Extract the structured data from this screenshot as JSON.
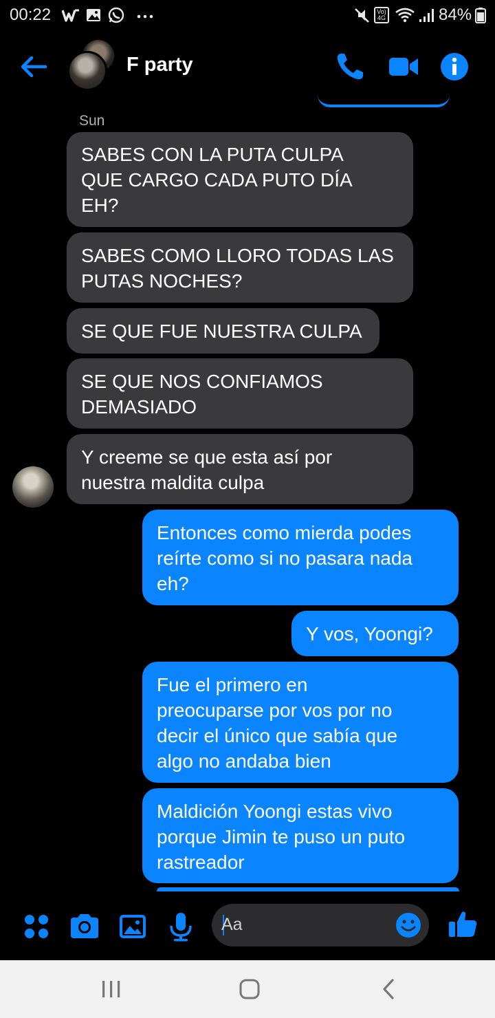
{
  "status_bar": {
    "time": "00:22",
    "battery": "84%",
    "volte": "Vo) 4G",
    "icons": [
      "w-app-icon",
      "gallery-icon",
      "whatsapp-icon",
      "more-dots-icon",
      "mute-icon",
      "volte-icon",
      "wifi-icon",
      "signal-icon",
      "battery-icon"
    ]
  },
  "header": {
    "title": "F party",
    "icons": [
      "back-arrow-icon",
      "phone-icon",
      "video-icon",
      "info-icon"
    ],
    "accent_color": "#0a84ff"
  },
  "conversation": {
    "date_label": "Sun",
    "messages": [
      {
        "direction": "in",
        "text": "SABES CON LA PUTA CULPA\nQUE CARGO CADA PUTO DÍA\nEH?"
      },
      {
        "direction": "in",
        "text": "SABES COMO LLORO TODAS LAS\nPUTAS NOCHES?"
      },
      {
        "direction": "in",
        "text": "SE QUE FUE NUESTRA CULPA"
      },
      {
        "direction": "in",
        "text": "SE QUE NOS CONFIAMOS\nDEMASIADO"
      },
      {
        "direction": "in",
        "text": "Y creeme se que esta así por\nnuestra maldita culpa"
      },
      {
        "direction": "out",
        "text": "Entonces como mierda podes\nreírte como si no pasara nada\neh?"
      },
      {
        "direction": "out",
        "text": "Y vos, Yoongi?"
      },
      {
        "direction": "out",
        "text": "Fue el primero en\npreocuparse por vos por no\ndecir el único que sabía que\nalgo no andaba bien"
      },
      {
        "direction": "out",
        "text": "Maldición Yoongi estas vivo\nporque Jimin te puso un puto\nrastreador"
      }
    ],
    "incoming_color": "#3a3a3c",
    "outgoing_color": "#0a84ff"
  },
  "composer": {
    "placeholder": "Aa",
    "icons": [
      "more-apps-icon",
      "camera-icon",
      "image-icon",
      "microphone-icon",
      "emoji-icon",
      "thumbs-up-icon"
    ]
  },
  "android_nav": {
    "icons": [
      "recent-apps-icon",
      "home-icon",
      "back-icon"
    ]
  }
}
